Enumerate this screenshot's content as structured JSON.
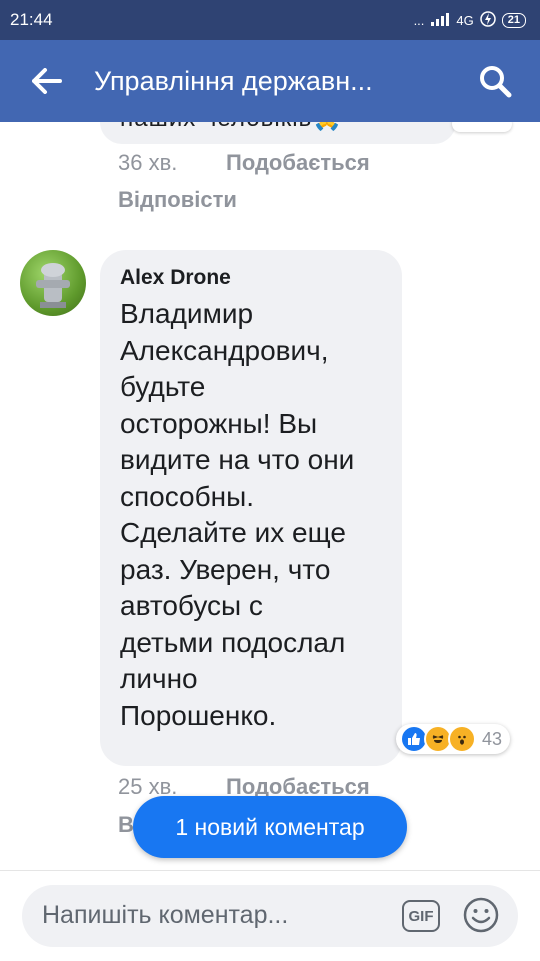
{
  "status_bar": {
    "time": "21:44",
    "dots": "...",
    "network": "4G",
    "battery": "21"
  },
  "app_bar": {
    "title": "Управління державн..."
  },
  "previous_comment": {
    "text_fragment": "наших человіків🙏",
    "time": "36 хв.",
    "like_label": "Подобається",
    "reply_label": "Відповісти"
  },
  "comment": {
    "author": "Alex Drone",
    "lines": [
      "Владимир",
      "Александрович,",
      "будьте",
      "осторожны! Вы",
      "видите на что они",
      "способны.",
      "Сделайте их еще",
      "раз. Уверен, что",
      "автобусы с",
      "детьми подослал",
      "лично",
      "Порошенко."
    ],
    "reaction_count": "43",
    "time": "25 хв.",
    "like_label": "Подобається",
    "reply_label_partial": "В"
  },
  "new_comment_pill": "1 новий коментар",
  "composer": {
    "placeholder": "Напишіть коментар...",
    "gif_label": "GIF"
  },
  "colors": {
    "status_bar": "#2f4373",
    "app_bar": "#4267b2",
    "bubble": "#f0f1f4",
    "pill": "#1877f2",
    "meta": "#90949c"
  }
}
